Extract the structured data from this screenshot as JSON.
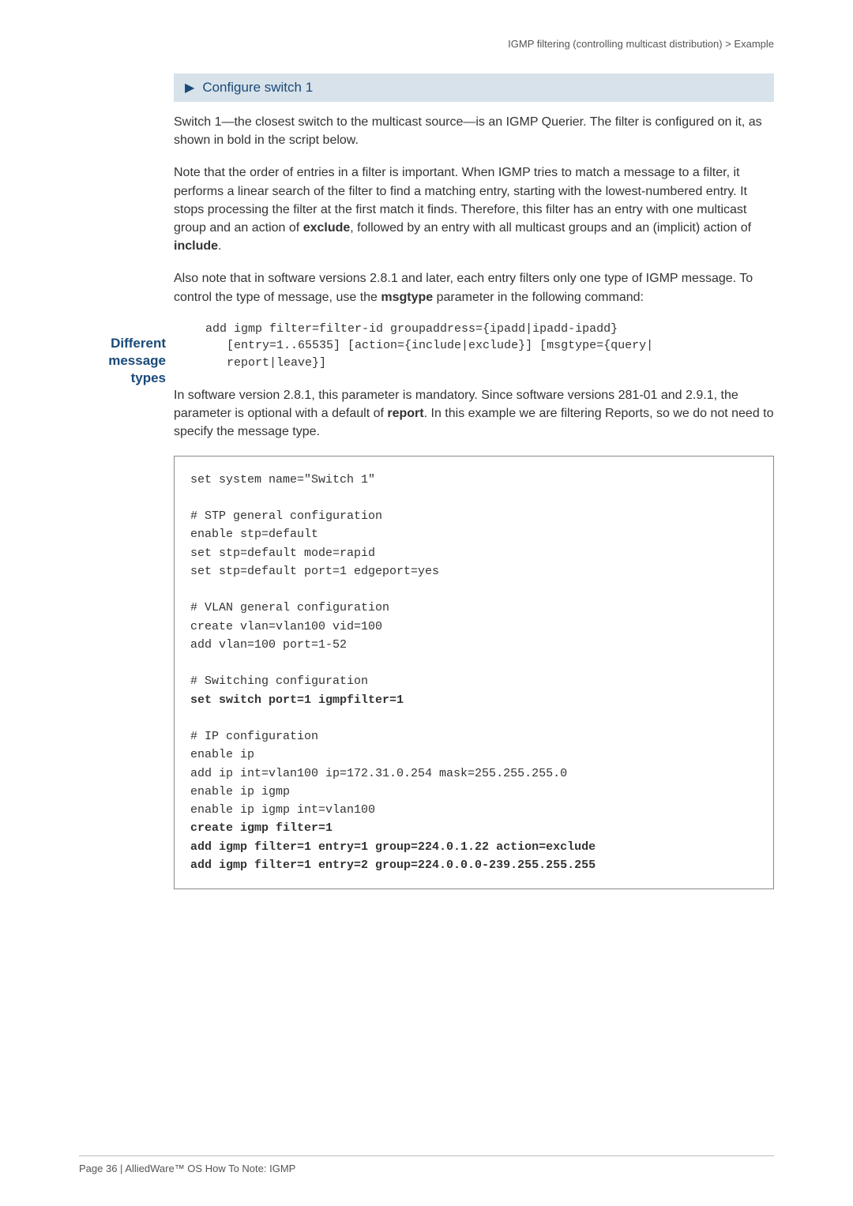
{
  "header": {
    "left": "IGMP filtering (controlling multicast distribution)",
    "separator": " > ",
    "right": "Example"
  },
  "section": {
    "heading": "Configure switch 1"
  },
  "para1": "Switch 1—the closest switch to the multicast source—is an IGMP Querier. The filter is configured on it, as shown in bold in the script below.",
  "para2_a": "Note that the order of entries in a filter is important. When IGMP tries to match a message to a filter, it performs a linear search of the filter to find a matching entry, starting with the lowest-numbered entry. It stops processing the filter at the first match it finds. Therefore, this filter has an entry with one multicast group and an action of ",
  "para2_b": "exclude",
  "para2_c": ", followed by an entry with all multicast groups and an (implicit) action of ",
  "para2_d": "include",
  "para2_e": ".",
  "side_label": "Different message types",
  "para3_a": "Also note that in software versions 2.8.1 and later, each entry filters only one type of IGMP message. To control the type of message, use the ",
  "para3_b": "msgtype",
  "para3_c": " parameter in the following command:",
  "code1": "add igmp filter=filter-id groupaddress={ipadd|ipadd-ipadd}\n   [entry=1..65535] [action={include|exclude}] [msgtype={query|\n   report|leave}]",
  "para4_a": "In software version 2.8.1, this parameter is mandatory. Since software versions 281-01 and 2.9.1, the parameter is optional with a default of ",
  "para4_b": "report",
  "para4_c": ". In this example we are filtering Reports, so we do not need to specify the message type.",
  "boxed": {
    "l1": "set system name=\"Switch 1\"",
    "l2": "",
    "l3": "# STP general configuration",
    "l4": "enable stp=default",
    "l5": "set stp=default mode=rapid",
    "l6": "set stp=default port=1 edgeport=yes",
    "l7": "",
    "l8": "# VLAN general configuration",
    "l9": "create vlan=vlan100 vid=100",
    "l10": "add vlan=100 port=1-52",
    "l11": "",
    "l12": "# Switching configuration",
    "l13": "set switch port=1 igmpfilter=1",
    "l14": "",
    "l15": "# IP configuration",
    "l16": "enable ip",
    "l17": "add ip int=vlan100 ip=172.31.0.254 mask=255.255.255.0",
    "l18": "enable ip igmp",
    "l19": "enable ip igmp int=vlan100",
    "l20": "create igmp filter=1",
    "l21": "add igmp filter=1 entry=1 group=224.0.1.22 action=exclude",
    "l22": "add igmp filter=1 entry=2 group=224.0.0.0-239.255.255.255"
  },
  "footer": "Page 36 | AlliedWare™ OS How To Note: IGMP"
}
